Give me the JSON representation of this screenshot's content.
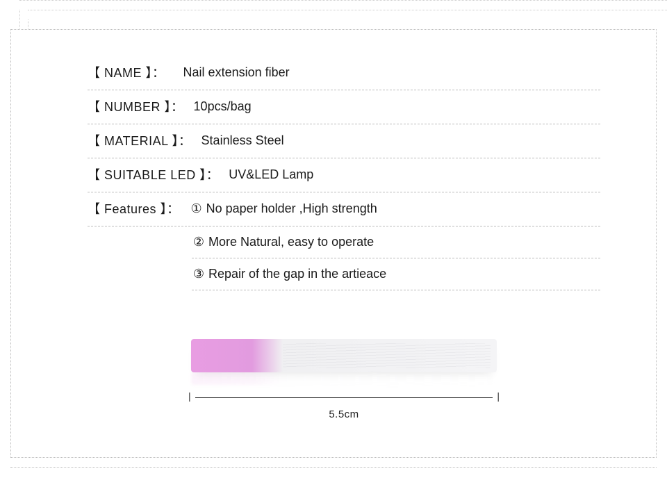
{
  "specs": {
    "name": {
      "label": "NAME",
      "value": "Nail extension fiber"
    },
    "number": {
      "label": "NUMBER",
      "value": "10pcs/bag"
    },
    "material": {
      "label": "MATERIAL",
      "value": "Stainless Steel"
    },
    "suitable_led": {
      "label": "SUITABLE LED",
      "value": "UV&LED Lamp"
    },
    "features": {
      "label": "Features",
      "items": [
        {
          "num": "①",
          "text": "No paper holder ,High strength"
        },
        {
          "num": "②",
          "text": "More Natural, easy to operate"
        },
        {
          "num": "③",
          "text": "Repair of the gap in the artieace"
        }
      ]
    }
  },
  "dimension": {
    "value": "5.5cm"
  }
}
